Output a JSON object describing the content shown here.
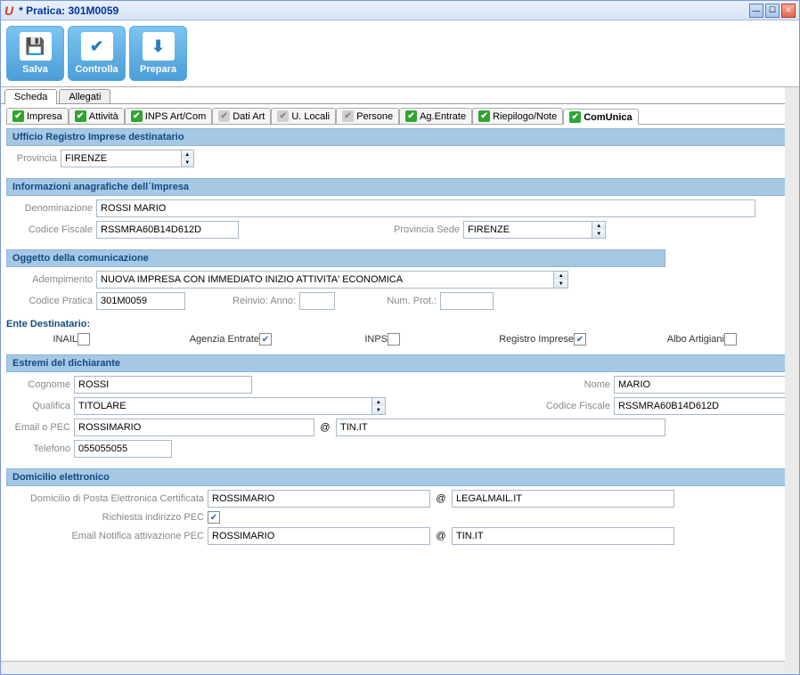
{
  "window": {
    "title": "* Pratica: 301M0059"
  },
  "toolbar": {
    "salva": "Salva",
    "controlla": "Controlla",
    "prepara": "Prepara"
  },
  "outerTabs": {
    "scheda": "Scheda",
    "allegati": "Allegati"
  },
  "innerTabs": [
    {
      "label": "Impresa",
      "state": "green"
    },
    {
      "label": "Attività",
      "state": "green"
    },
    {
      "label": "INPS Art/Com",
      "state": "green"
    },
    {
      "label": "Dati Art",
      "state": "gray"
    },
    {
      "label": "U. Locali",
      "state": "gray"
    },
    {
      "label": "Persone",
      "state": "gray"
    },
    {
      "label": "Ag.Entrate",
      "state": "green"
    },
    {
      "label": "Riepilogo/Note",
      "state": "green"
    },
    {
      "label": "ComUnica",
      "state": "green"
    }
  ],
  "sections": {
    "ufficio": {
      "header": "Ufficio Registro Imprese destinatario",
      "provincia_label": "Provincia",
      "provincia": "FIRENZE"
    },
    "anagrafica": {
      "header": "Informazioni anagrafiche dell´Impresa",
      "den_label": "Denominazione",
      "denominazione": "ROSSI MARIO",
      "cf_label": "Codice Fiscale",
      "codice_fiscale": "RSSMRA60B14D612D",
      "prov_sede_label": "Provincia Sede",
      "provincia_sede": "FIRENZE"
    },
    "oggetto": {
      "header": "Oggetto della comunicazione",
      "adempimento_label": "Adempimento",
      "adempimento": "NUOVA IMPRESA CON IMMEDIATO INIZIO ATTIVITA' ECONOMICA",
      "codprat_label": "Codice Pratica",
      "codice_pratica": "301M0059",
      "reinvio_label": "Reinvio: Anno:",
      "reinvio_anno": "",
      "numprot_label": "Num. Prot.:",
      "num_prot": ""
    },
    "ente": {
      "header": "Ente Destinatario:",
      "inail_label": "INAIL",
      "inail": false,
      "ae_label": "Agenzia Entrate",
      "ae": true,
      "inps_label": "INPS",
      "inps": false,
      "ri_label": "Registro Imprese",
      "ri": true,
      "albo_label": "Albo Artigiani",
      "albo": false
    },
    "dichiarante": {
      "header": "Estremi del dichiarante",
      "cognome_label": "Cognome",
      "cognome": "ROSSI",
      "nome_label": "Nome",
      "nome": "MARIO",
      "qualifica_label": "Qualifica",
      "qualifica": "TITOLARE",
      "cf_label": "Codice Fiscale",
      "codice_fiscale": "RSSMRA60B14D612D",
      "email_label": "Email o PEC",
      "email_user": "ROSSIMARIO",
      "at": "@",
      "email_domain": "TIN.IT",
      "tel_label": "Telefono",
      "telefono": "055055055"
    },
    "domicilio": {
      "header": "Domicilio elettronico",
      "pec_label": "Domicilio di Posta Elettronica Certificata",
      "pec_user": "ROSSIMARIO",
      "at": "@",
      "pec_domain": "LEGALMAIL.IT",
      "richiesta_label": "Richiesta indirizzo PEC",
      "richiesta": true,
      "notifica_label": "Email Notifica attivazione PEC",
      "notifica_user": "ROSSIMARIO",
      "notifica_domain": "TIN.IT"
    }
  }
}
